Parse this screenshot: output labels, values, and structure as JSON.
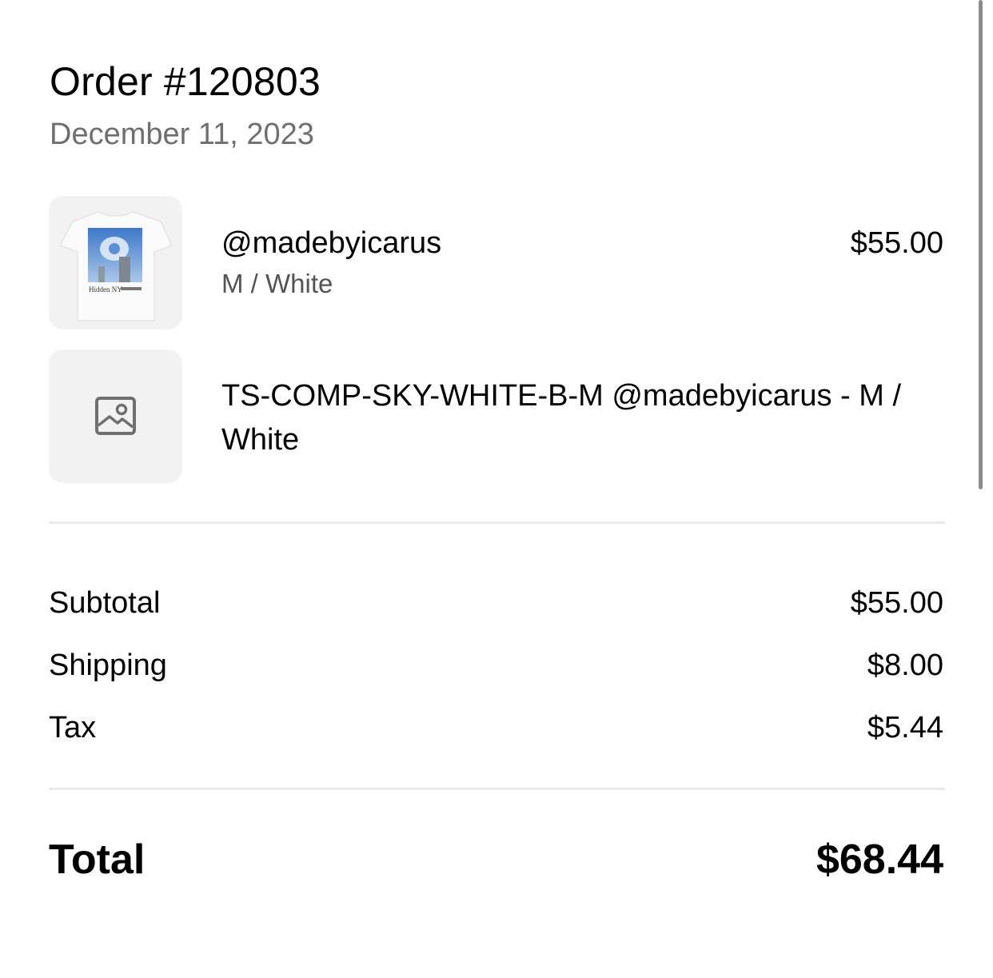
{
  "order": {
    "title": "Order #120803",
    "date": "December 11, 2023"
  },
  "items": [
    {
      "name": "@madebyicarus",
      "variant": "M / White",
      "price": "$55.00",
      "thumbnail_text": "Hidden NY",
      "icon": "tshirt-thumbnail"
    },
    {
      "name": "TS-COMP-SKY-WHITE-B-M @madebyicarus - M / White",
      "icon": "image-placeholder-icon"
    }
  ],
  "summary": {
    "subtotal_label": "Subtotal",
    "subtotal_value": "$55.00",
    "shipping_label": "Shipping",
    "shipping_value": "$8.00",
    "tax_label": "Tax",
    "tax_value": "$5.44",
    "total_label": "Total",
    "total_value": "$68.44"
  },
  "colors": {
    "text": "#000000",
    "secondary_text": "#6f6f6f",
    "thumbnail_bg": "#f2f2f2",
    "divider": "#eaeaea",
    "placeholder_icon": "#707070"
  }
}
